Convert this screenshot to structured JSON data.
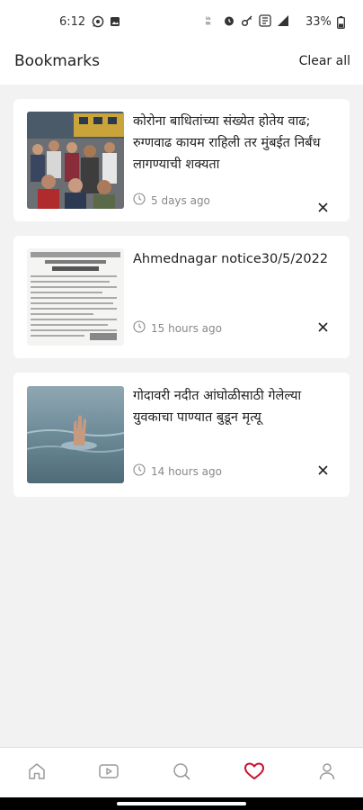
{
  "status_bar": {
    "time": "6:12",
    "battery": "33%",
    "icons": [
      "whatsapp-icon",
      "gallery-icon",
      "vowifi-icon",
      "alarm-icon",
      "key-icon",
      "data-icon",
      "signal-icon",
      "battery-icon"
    ]
  },
  "header": {
    "title": "Bookmarks",
    "clear_all_label": "Clear all"
  },
  "bookmarks": [
    {
      "title": "कोरोना बाधितांच्या संख्येत होतेय वाढ; रुग्णवाढ कायम राहिली तर मुंबईत निर्बंध लागण्याची शक्यता",
      "time_ago": "5 days ago",
      "thumbnail": "crowded-railway-station-photo"
    },
    {
      "title": "Ahmednagar notice30/5/2022",
      "time_ago": "15 hours ago",
      "thumbnail": "printed-notice-document-photo"
    },
    {
      "title": "गोदावरी नदीत आंघोळीसाठी गेलेल्या युवकाचा पाण्यात बुडून मृत्यू",
      "time_ago": "14 hours ago",
      "thumbnail": "hand-in-water-photo"
    }
  ],
  "bottom_nav": {
    "items": [
      "home-icon",
      "video-icon",
      "search-icon",
      "bookmarks-heart-icon",
      "profile-icon"
    ],
    "active": "bookmarks-heart-icon",
    "active_color": "#c8102e",
    "inactive_color": "#9a9a9a"
  }
}
